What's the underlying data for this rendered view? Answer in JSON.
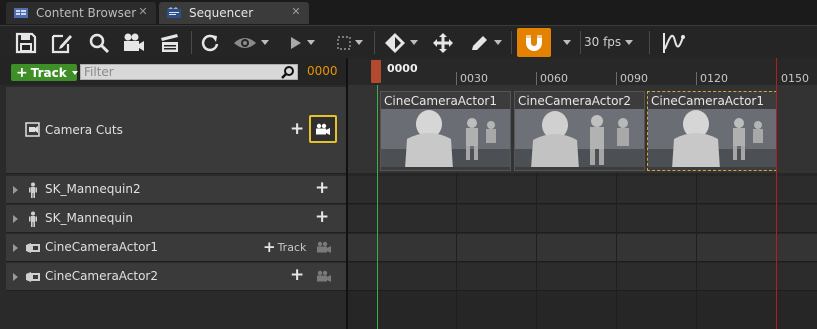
{
  "tabs": [
    {
      "label": "Content Browser",
      "icon": "content-browser-icon",
      "close": "✕"
    },
    {
      "label": "Sequencer",
      "icon": "sequencer-icon",
      "close": "✕"
    }
  ],
  "toolbar": {
    "fps_label": "30 fps",
    "accent": "#e28200"
  },
  "outliner": {
    "add_track_label": "Track",
    "filter_placeholder": "Filter",
    "frame_counter": "0000",
    "rows": [
      {
        "label": "Camera Cuts",
        "icon": "camera-cuts-icon"
      },
      {
        "label": "SK_Mannequin2",
        "icon": "skeletal-mesh-icon"
      },
      {
        "label": "SK_Mannequin",
        "icon": "skeletal-mesh-icon"
      },
      {
        "label": "CineCameraActor1",
        "icon": "cine-camera-icon",
        "add_track_label": "Track"
      },
      {
        "label": "CineCameraActor2",
        "icon": "cine-camera-icon"
      }
    ]
  },
  "timeline": {
    "current_frame": "0000",
    "ticks": [
      "0030",
      "0060",
      "0090",
      "0120",
      "0150"
    ],
    "shots": [
      {
        "label": "CineCameraActor1"
      },
      {
        "label": "CineCameraActor2"
      },
      {
        "label": "CineCameraActor1"
      }
    ]
  }
}
